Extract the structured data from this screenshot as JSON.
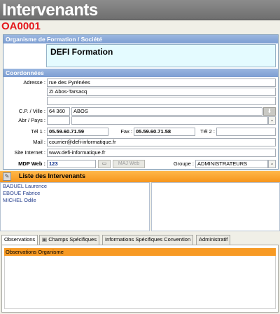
{
  "header": {
    "title": "Intervenants"
  },
  "record": {
    "code": "OA0001"
  },
  "organisme": {
    "section_label": "Organisme de Formation / Société",
    "name": "DEFI Formation"
  },
  "coordonnees": {
    "section_label": "Coordonnées",
    "adresse_label": "Adresse :",
    "adresse_line1": "rue des Pyrénées",
    "adresse_line2": "ZI Abos-Tarsacq",
    "adresse_line3": "",
    "cp_ville_label": "C.P. / Ville :",
    "cp": "64 360",
    "ville": "ABOS",
    "abr_pays_label": "Abr / Pays :",
    "abr": "",
    "pays": "",
    "tel1_label": "Tél 1 :",
    "tel1": "05.59.60.71.59",
    "fax_label": "Fax :",
    "fax": "05.59.60.71.58",
    "tel2_label": "Tél 2 :",
    "tel2": "",
    "mail_label": "Mail :",
    "mail": "courrier@defi-informatique.fr",
    "site_label": "Site Internet :",
    "site": "www.defi-informatique.fr",
    "mdp_label": "MDP Web :",
    "mdp": "123",
    "maj_label": "MAJ Web",
    "groupe_label": "Groupe :",
    "groupe": "ADMINISTRATEURS"
  },
  "intervenants": {
    "title": "Liste des Intervenants",
    "items": [
      "BADUEL Laurence",
      "EBOUE Fabrice",
      "MICHEL Odile"
    ]
  },
  "tabs": [
    {
      "label": "Observations"
    },
    {
      "label": "Champs Spécifiques"
    },
    {
      "label": "Informations Spécifiques Convention"
    },
    {
      "label": "Administratif"
    }
  ],
  "observations": {
    "header": "Observations Organisme"
  },
  "colors": {
    "accent_orange": "#f6951c",
    "section_blue": "#7d9ed2",
    "code_red": "#e4181d"
  }
}
